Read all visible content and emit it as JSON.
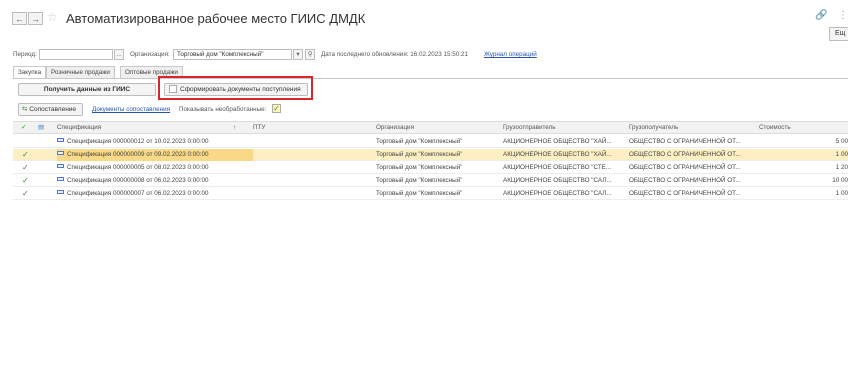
{
  "window": {
    "title": "Автоматизированное рабочее место ГИИС ДМДК",
    "more_label": "Ещ"
  },
  "filter": {
    "period_label": "Период:",
    "period_value": "",
    "period_button": "...",
    "org_label": "Организация:",
    "org_value": "Торговый дом \"Комплексный\"",
    "last_update_label": "Дата последнего обновления: 16.02.2023 15:50:21",
    "journal_link": "Журнал операций"
  },
  "tabs": [
    {
      "label": "Закупка",
      "active": true
    },
    {
      "label": "Розничные продажи",
      "active": false
    },
    {
      "label": "Оптовые продажи",
      "active": false
    }
  ],
  "toolbar": {
    "get_data_label": "Получить данные из ГИИС",
    "create_docs_label": "Сформировать документы поступления",
    "match_label": "Сопоставление",
    "match_docs_link": "Документы сопоставления",
    "show_unprocessed_label": "Показывать необработанные:"
  },
  "grid": {
    "columns": [
      "Спецификация",
      "ПТУ",
      "Организация",
      "Грузоотправитель",
      "Грузополучатель",
      "Стоимость"
    ],
    "sort_indicator": "↑",
    "rows": [
      {
        "checked": false,
        "spec": "Спецификация 000000012 от 10.02.2023 0:00:00",
        "ptu": "",
        "org": "Торговый дом \"Комплексный\"",
        "sender": "АКЦИОНЕРНОЕ ОБЩЕСТВО \"ХАЙ...",
        "receiver": "ОБЩЕСТВО С ОГРАНИЧЕННОЙ ОТ...",
        "cost": "5 00",
        "selected": false
      },
      {
        "checked": true,
        "spec": "Спецификация 000000009 от 09.02.2023 0:00:00",
        "ptu": "",
        "org": "Торговый дом \"Комплексный\"",
        "sender": "АКЦИОНЕРНОЕ ОБЩЕСТВО \"ХАЙ...",
        "receiver": "ОБЩЕСТВО С ОГРАНИЧЕННОЙ ОТ...",
        "cost": "1 00",
        "selected": true
      },
      {
        "checked": true,
        "spec": "Спецификация 000000005 от 08.02.2023 0:00:00",
        "ptu": "",
        "org": "Торговый дом \"Комплексный\"",
        "sender": "АКЦИОНЕРНОЕ ОБЩЕСТВО \"СТЕ...",
        "receiver": "ОБЩЕСТВО С ОГРАНИЧЕННОЙ ОТ...",
        "cost": "1 20",
        "selected": false
      },
      {
        "checked": true,
        "spec": "Спецификация 000000008 от 06.02.2023 0:00:00",
        "ptu": "",
        "org": "Торговый дом \"Комплексный\"",
        "sender": "АКЦИОНЕРНОЕ ОБЩЕСТВО \"САЛ...",
        "receiver": "ОБЩЕСТВО С ОГРАНИЧЕННОЙ ОТ...",
        "cost": "10 00",
        "selected": false
      },
      {
        "checked": true,
        "spec": "Спецификация 000000007 от 06.02.2023 0:00:00",
        "ptu": "",
        "org": "Торговый дом \"Комплексный\"",
        "sender": "АКЦИОНЕРНОЕ ОБЩЕСТВО \"САЛ...",
        "receiver": "ОБЩЕСТВО С ОГРАНИЧЕННОЙ ОТ...",
        "cost": "1 00",
        "selected": false
      }
    ]
  },
  "colors": {
    "accent_link": "#2857a8",
    "highlight_red": "#d8272b",
    "selected_row": "#fbefc3",
    "check_green": "#3a8a2e"
  }
}
